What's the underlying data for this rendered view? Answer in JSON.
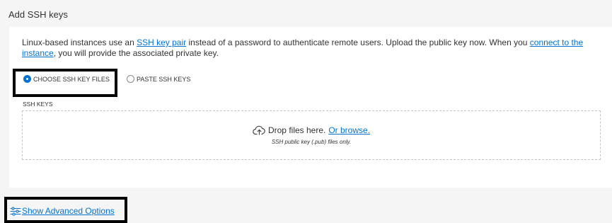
{
  "section": {
    "title": "Add SSH keys"
  },
  "description": {
    "part1": "Linux-based instances use an ",
    "link1": "SSH key pair",
    "part2": " instead of a password to authenticate remote users. Upload the public key now. When you ",
    "link2": "connect to the instance",
    "part3": ", you will provide the associated private key."
  },
  "key_source": {
    "options": [
      {
        "label": "CHOOSE SSH KEY FILES",
        "selected": true
      },
      {
        "label": "PASTE SSH KEYS",
        "selected": false
      }
    ]
  },
  "ssh_keys": {
    "label": "SSH KEYS",
    "drop_text": "Drop files here.",
    "browse_link": "Or browse.",
    "hint": "SSH public key (.pub) files only.",
    "icon": "cloud-upload-icon"
  },
  "advanced": {
    "label": "Show Advanced Options",
    "icon": "sliders-icon"
  },
  "colors": {
    "link": "#0572ce",
    "highlight": "#000000",
    "panel": "#ffffff",
    "page": "#f5f5f5"
  }
}
